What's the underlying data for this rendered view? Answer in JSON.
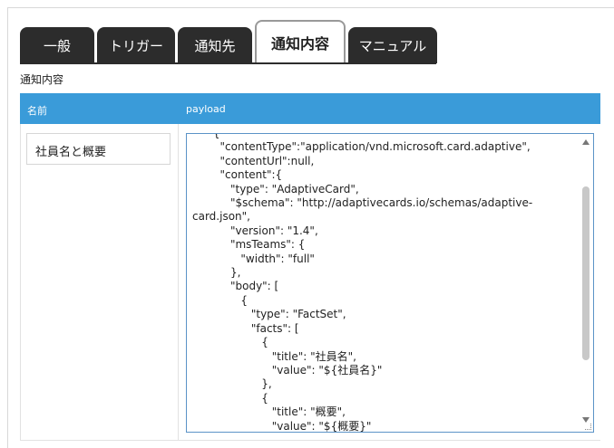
{
  "tabs": [
    {
      "label": "一般",
      "active": false
    },
    {
      "label": "トリガー",
      "active": false
    },
    {
      "label": "通知先",
      "active": false
    },
    {
      "label": "通知内容",
      "active": true
    },
    {
      "label": "マニュアル",
      "active": false
    }
  ],
  "section_label": "通知内容",
  "table": {
    "col_name": "名前",
    "col_payload": "payload"
  },
  "row": {
    "name": "社員名と概要",
    "payload_text": "      {\n        \"contentType\":\"application/vnd.microsoft.card.adaptive\",\n        \"contentUrl\":null,\n        \"content\":{\n           \"type\": \"AdaptiveCard\",\n           \"$schema\": \"http://adaptivecards.io/schemas/adaptive-card.json\",\n           \"version\": \"1.4\",\n           \"msTeams\": {\n              \"width\": \"full\"\n           },\n           \"body\": [\n              {\n                 \"type\": \"FactSet\",\n                 \"facts\": [\n                    {\n                       \"title\": \"社員名\",\n                       \"value\": \"${社員名}\"\n                    },\n                    {\n                       \"title\": \"概要\",\n                       \"value\": \"${概要}\"\n                    }\n                 ]"
  },
  "colors": {
    "header_bg": "#3a9bd9",
    "tab_bg": "#2c2c2c",
    "textarea_border": "#5b93c7"
  },
  "icons": {
    "scroll_up": "triangle-up-icon",
    "scroll_down": "triangle-down-icon",
    "resize": "resize-grip-icon"
  }
}
